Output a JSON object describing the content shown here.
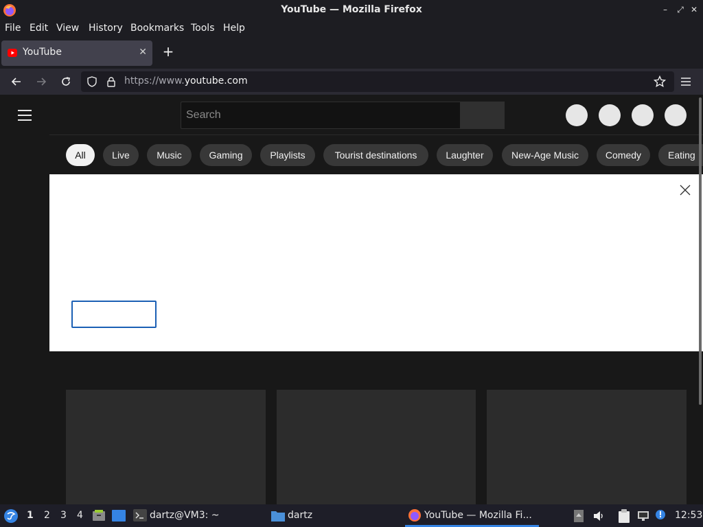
{
  "window": {
    "title": "YouTube — Mozilla Firefox"
  },
  "menubar": [
    "File",
    "Edit",
    "View",
    "History",
    "Bookmarks",
    "Tools",
    "Help"
  ],
  "tabs": [
    {
      "label": "YouTube",
      "active": true,
      "icon": "youtube-icon"
    }
  ],
  "urlbar": {
    "prefix": "https://www.",
    "domain": "youtube.com"
  },
  "youtube": {
    "search_placeholder": "Search",
    "chips": [
      "All",
      "Live",
      "Music",
      "Gaming",
      "Playlists",
      "Tourist destinations",
      "Laughter",
      "New-Age Music",
      "Comedy",
      "Eating"
    ],
    "selected_chip": "All"
  },
  "taskbar": {
    "workspaces": [
      "1",
      "2",
      "3",
      "4"
    ],
    "terminal_label": "dartz@VM3: ~",
    "folder_label": "dartz",
    "firefox_label": "YouTube — Mozilla Fi...",
    "clock": "12:53"
  },
  "colors": {
    "chip_active_bg": "#f1f1f1",
    "chip_bg": "#383838",
    "focus_outline": "#1a5fb4",
    "youtube_red": "#ff0000"
  }
}
